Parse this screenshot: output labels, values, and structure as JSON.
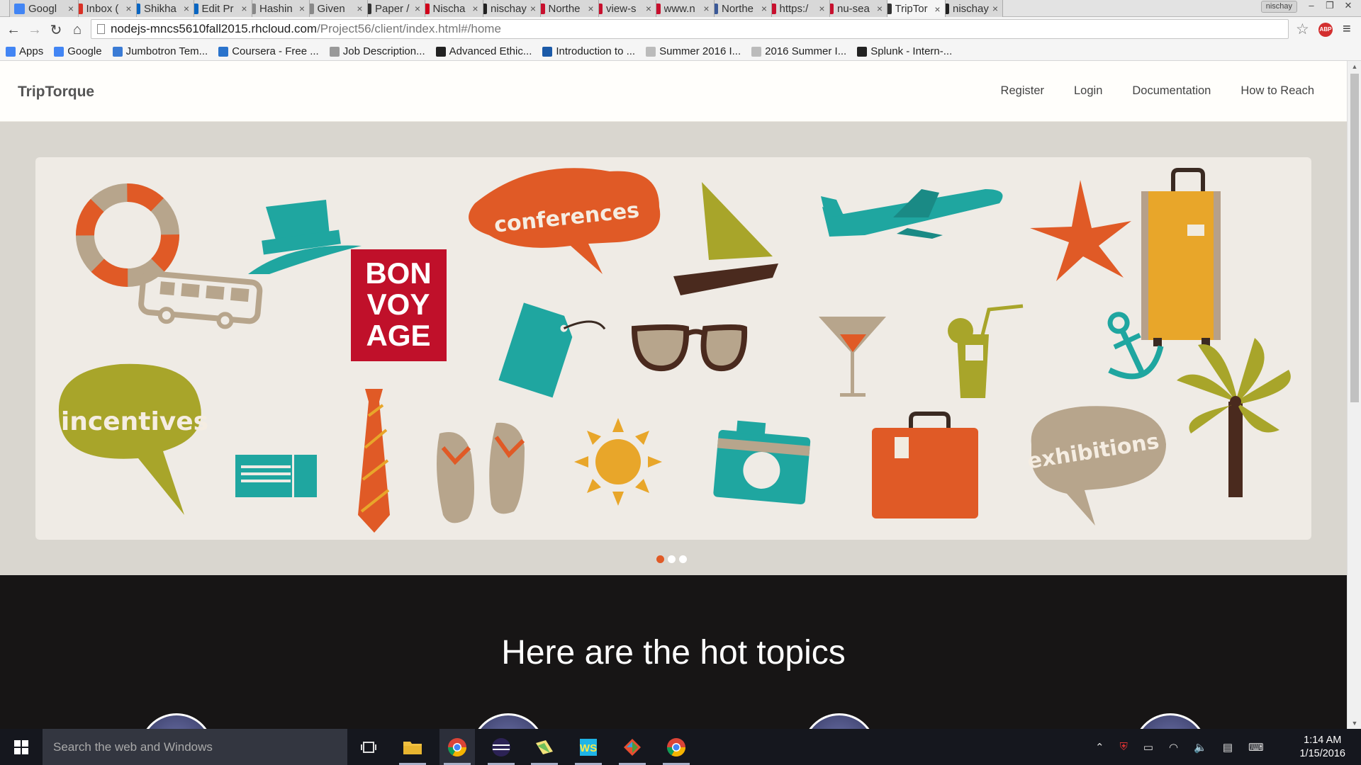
{
  "browser": {
    "tabs": [
      {
        "title": "Googl",
        "favicon": "google-icon",
        "color": "#4285f4"
      },
      {
        "title": "Inbox (",
        "favicon": "gmail-icon",
        "color": "#d93025"
      },
      {
        "title": "Shikha",
        "favicon": "linkedin-icon",
        "color": "#0a66c2"
      },
      {
        "title": "Edit Pr",
        "favicon": "linkedin-icon",
        "color": "#0a66c2"
      },
      {
        "title": "Hashin",
        "favicon": "page-icon",
        "color": "#888888"
      },
      {
        "title": "Given",
        "favicon": "page-icon",
        "color": "#888888"
      },
      {
        "title": "Paper /",
        "favicon": "link-icon",
        "color": "#333333"
      },
      {
        "title": "Nischa",
        "favicon": "record-icon",
        "color": "#d0021b"
      },
      {
        "title": "nischay",
        "favicon": "github-icon",
        "color": "#222222"
      },
      {
        "title": "Northe",
        "favicon": "northeastern-icon",
        "color": "#c8102e"
      },
      {
        "title": "view-s",
        "favicon": "northeastern-icon",
        "color": "#c8102e"
      },
      {
        "title": "www.n",
        "favicon": "northeastern-icon",
        "color": "#c8102e"
      },
      {
        "title": "Northe",
        "favicon": "facebook-icon",
        "color": "#3b5998"
      },
      {
        "title": "https:/",
        "favicon": "northeastern-icon",
        "color": "#c8102e"
      },
      {
        "title": "nu-sea",
        "favicon": "northeastern-icon",
        "color": "#c8102e"
      },
      {
        "title": "TripTor",
        "favicon": "link-icon",
        "color": "#333333",
        "active": true
      },
      {
        "title": "nischay",
        "favicon": "github-icon",
        "color": "#222222"
      }
    ],
    "profile_label": "nischay",
    "url_host": "nodejs-mncs5610fall2015.rhcloud.com",
    "url_path": "/Project56/client/index.html#/home",
    "abp_label": "ABP",
    "bookmarks": [
      {
        "label": "Apps",
        "icon": "apps-grid-icon"
      },
      {
        "label": "Google",
        "icon": "google-icon"
      },
      {
        "label": "Jumbotron Tem...",
        "icon": "bootstrap-icon"
      },
      {
        "label": "Coursera - Free ...",
        "icon": "coursera-icon"
      },
      {
        "label": "Job Description...",
        "icon": "page-icon"
      },
      {
        "label": "Advanced Ethic...",
        "icon": "ethics-icon"
      },
      {
        "label": "Introduction to ...",
        "icon": "e-icon"
      },
      {
        "label": "Summer 2016 I...",
        "icon": "cloud-icon"
      },
      {
        "label": "2016 Summer I...",
        "icon": "cloud-icon"
      },
      {
        "label": "Splunk - Intern-...",
        "icon": "splunk-icon"
      }
    ]
  },
  "site": {
    "brand": "TripTorque",
    "nav": [
      "Register",
      "Login",
      "Documentation",
      "How to Reach"
    ],
    "carousel": {
      "bubbles": {
        "conferences": "conferences",
        "incentives": "incentives",
        "exhibitions": "exhibitions"
      },
      "sign_lines": [
        "BON",
        "VOY",
        "AGE"
      ],
      "slide_count": 3,
      "active_slide": 1,
      "colors": {
        "orange": "#e05a26",
        "teal": "#1fa6a0",
        "olive": "#a8a52a",
        "tan": "#b7a58c",
        "mustard": "#e8a62a",
        "red": "#c0102a",
        "brown": "#4a2a1e"
      }
    },
    "hot_topics_title": "Here are the hot topics"
  },
  "taskbar": {
    "search_placeholder": "Search the web and Windows",
    "time": "1:14 AM",
    "date": "1/15/2016"
  }
}
